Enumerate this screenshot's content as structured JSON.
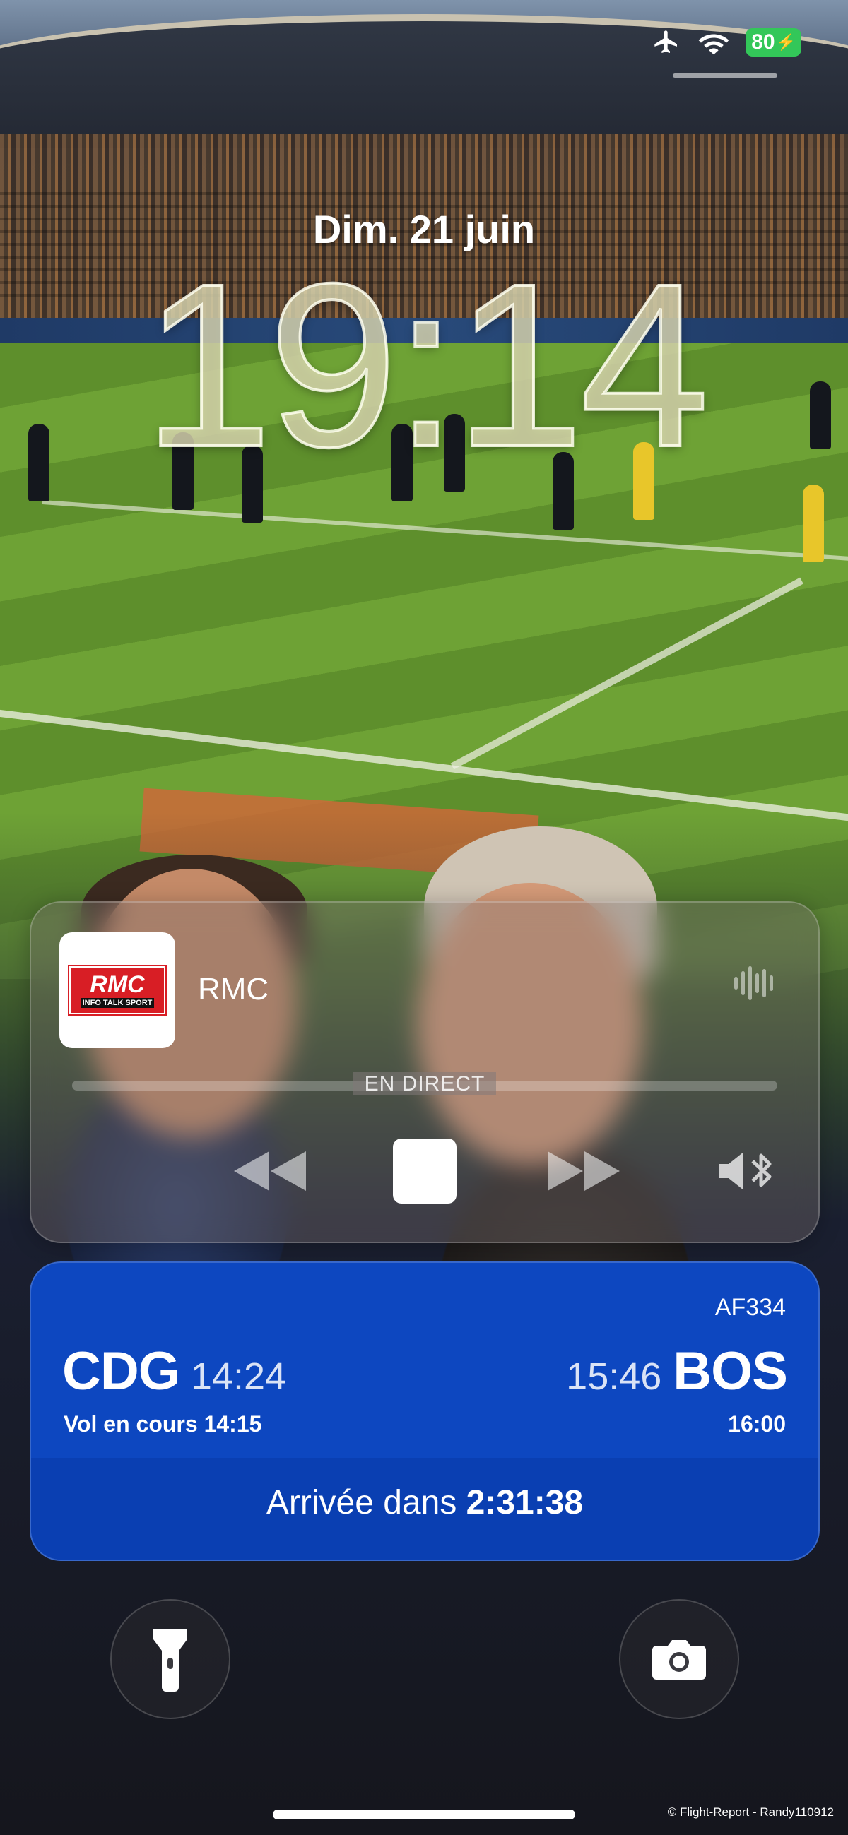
{
  "status_bar": {
    "airplane_icon": "airplane-icon",
    "wifi_icon": "wifi-icon",
    "battery_level": "80",
    "battery_color": "#33c759"
  },
  "lock_screen": {
    "date": "Dim. 21 juin",
    "time": "19:14"
  },
  "now_playing": {
    "logo_text": "RMC",
    "logo_subtext": "INFO TALK SPORT",
    "station": "RMC",
    "live_label": "EN DIRECT",
    "controls": [
      "rewind-icon",
      "stop-icon",
      "fast-forward-icon",
      "audio-output-icon"
    ]
  },
  "flight": {
    "flight_number": "AF334",
    "origin_code": "CDG",
    "origin_time": "14:24",
    "status_text": "Vol en cours",
    "status_time": "14:15",
    "dest_time": "15:46",
    "dest_code": "BOS",
    "dest_actual_time": "16:00",
    "arrival_label": "Arrivée dans",
    "arrival_countdown": "2:31:38",
    "background_color": "#0d47c0"
  },
  "quick_actions": {
    "flashlight": "flashlight-icon",
    "camera": "camera-icon"
  },
  "credit": "© Flight-Report - Randy110912"
}
